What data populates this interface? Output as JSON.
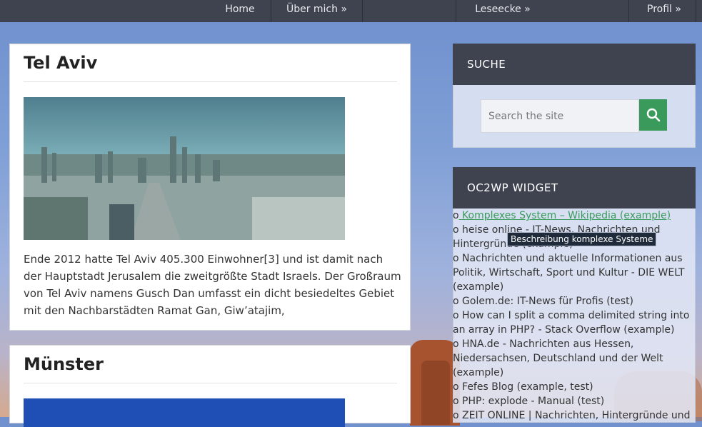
{
  "nav": {
    "items": [
      "Home",
      "Über mich »",
      "Leseecke »",
      "Profil »"
    ]
  },
  "posts": [
    {
      "title": "Tel Aviv",
      "text": "Ende 2012 hatte Tel Aviv 405.300 Einwohner[3] und ist damit nach der Hauptstadt Jerusalem die zweitgrößte Stadt Israels. Der Großraum von Tel Aviv namens Gusch Dan umfasst ein dicht besiedeltes Gebiet mit den Nachbarstädten Ramat Gan, Giw’atajim,"
    },
    {
      "title": "Münster",
      "text": ""
    }
  ],
  "sidebar": {
    "search": {
      "heading": "SUCHE",
      "placeholder": "Search the site"
    },
    "oc2wp": {
      "heading": "OC2WP WIDGET",
      "bullet": "o",
      "links": [
        " Komplexes System – Wikipedia (example)",
        " heise online - IT-News, Nachrichten und Hintergründe (example)",
        " Nachrichten und aktuelle Informationen aus Politik, Wirtschaft, Sport und Kultur - DIE WELT (example)",
        " Golem.de: IT-News für Profis (test)",
        " How can I split a comma delimited string into an array in PHP? - Stack Overflow (example)",
        " HNA.de - Nachrichten aus Hessen, Niedersachsen, Deutschland und der Welt (example)",
        " Fefes Blog (example, test)",
        " PHP: explode - Manual (test)",
        " ZEIT ONLINE | Nachrichten, Hintergründe und"
      ],
      "tooltip": "Beschreibung komplexe Systeme"
    }
  },
  "colors": {
    "nav_bg": "#3f4350",
    "accent_green": "#3a9a5b"
  }
}
